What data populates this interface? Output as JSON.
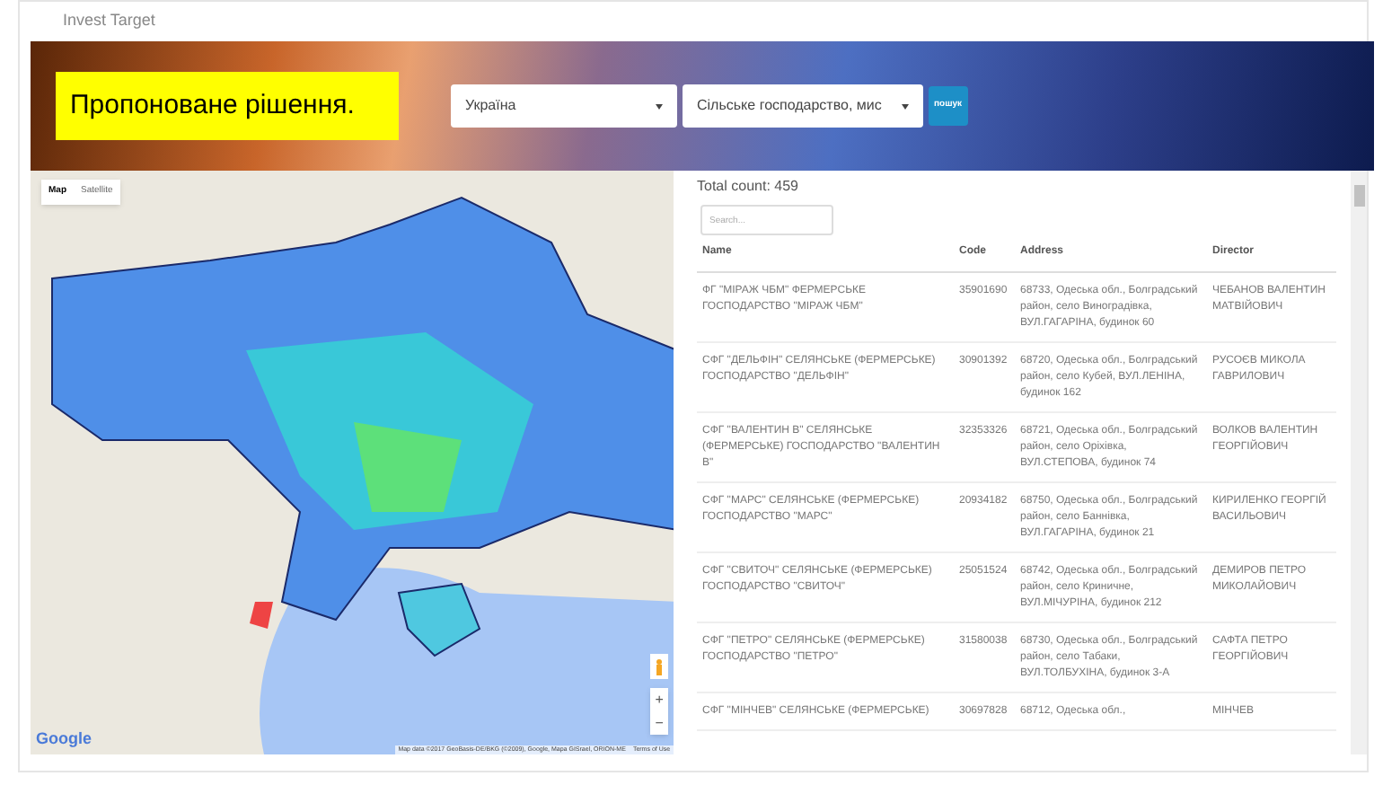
{
  "app_title": "Invest Target",
  "banner": {
    "headline": "Пропоноване рішення.",
    "region_select": "Україна",
    "sector_select": "Сільське господарство, мис",
    "button": "пошук"
  },
  "map": {
    "type_tabs": [
      {
        "label": "Map",
        "selected": true
      },
      {
        "label": "Satellite",
        "selected": false
      }
    ],
    "zoom_in": "+",
    "zoom_out": "−",
    "logo": "Google",
    "attribution": "Map data ©2017 GeoBasis-DE/BKG (©2009), Google, Mapa GISrael, ORION-ME",
    "terms": "Terms of Use"
  },
  "results": {
    "total": "Total count: 459",
    "search": {
      "placeholder": "Search..."
    },
    "columns": [
      "Name",
      "Code",
      "Address",
      "Director"
    ],
    "rows": [
      [
        "ФГ \"МІРАЖ ЧБМ\" ФЕРМЕРСЬКЕ ГОСПОДАРСТВО \"МІРАЖ ЧБМ\"",
        "35901690",
        "68733, Одеська обл., Болградський район, село Виноградівка, ВУЛ.ГАГАРІНА, будинок 60",
        "ЧЕБАНОВ ВАЛЕНТИН МАТВІЙОВИЧ"
      ],
      [
        "СФГ \"ДЕЛЬФІН\" СЕЛЯНСЬКЕ (ФЕРМЕРСЬКЕ) ГОСПОДАРСТВО \"ДЕЛЬФІН\"",
        "30901392",
        "68720, Одеська обл., Болградський район, село Кубей, ВУЛ.ЛЕНІНА, будинок 162",
        "РУСОЄВ МИКОЛА ГАВРИЛОВИЧ"
      ],
      [
        "СФГ \"ВАЛЕНТИН В\" СЕЛЯНСЬКЕ (ФЕРМЕРСЬКЕ) ГОСПОДАРСТВО \"ВАЛЕНТИН В\"",
        "32353326",
        "68721, Одеська обл., Болградський район, село Оріхівка, ВУЛ.СТЕПОВА, будинок 74",
        "ВОЛКОВ ВАЛЕНТИН ГЕОРГІЙОВИЧ"
      ],
      [
        "СФГ \"МАРС\" СЕЛЯНСЬКЕ (ФЕРМЕРСЬКЕ) ГОСПОДАРСТВО \"МАРС\"",
        "20934182",
        "68750, Одеська обл., Болградський район, село Баннівка, ВУЛ.ГАГАРІНА, будинок 21",
        "КИРИЛЕНКО ГЕОРГІЙ ВАСИЛЬОВИЧ"
      ],
      [
        "СФГ \"СВИТОЧ\" СЕЛЯНСЬКЕ (ФЕРМЕРСЬКЕ) ГОСПОДАРСТВО \"СВИТОЧ\"",
        "25051524",
        "68742, Одеська обл., Болградський район, село Криничне, ВУЛ.МІЧУРІНА, будинок 212",
        "ДЕМИРОВ ПЕТРО МИКОЛАЙОВИЧ"
      ],
      [
        "СФГ \"ПЕТРО\" СЕЛЯНСЬКЕ (ФЕРМЕРСЬКЕ) ГОСПОДАРСТВО \"ПЕТРО\"",
        "31580038",
        "68730, Одеська обл., Болградський район, село Табаки, ВУЛ.ТОЛБУХІНА, будинок 3-А",
        "САФТА ПЕТРО ГЕОРГІЙОВИЧ"
      ],
      [
        "СФГ \"МІНЧЕВ\" СЕЛЯНСЬКЕ (ФЕРМЕРСЬКЕ)",
        "30697828",
        "68712, Одеська обл.,",
        "МІНЧЕВ"
      ]
    ]
  }
}
